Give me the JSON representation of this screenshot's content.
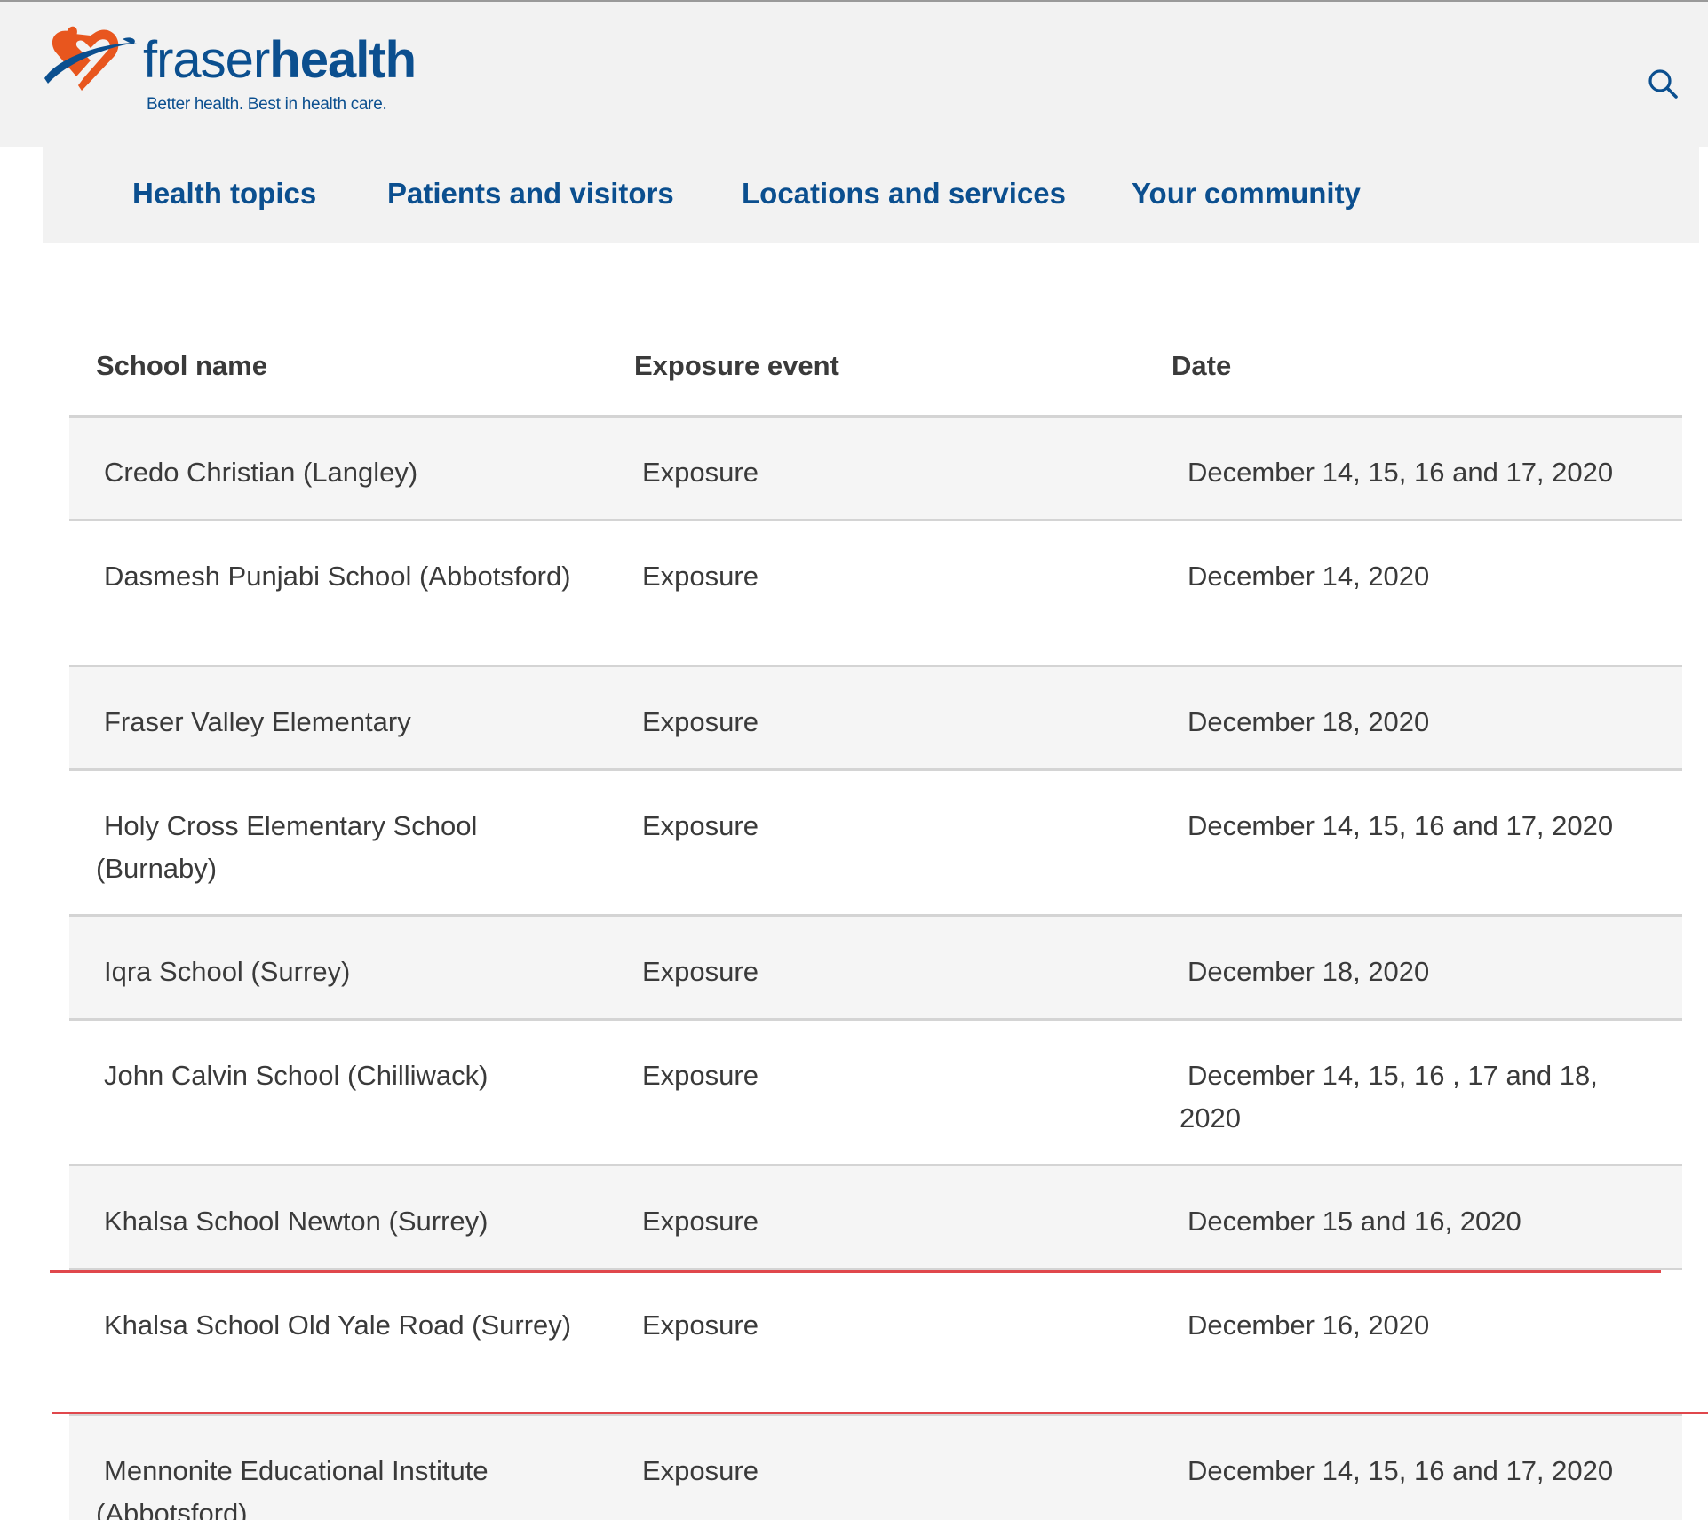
{
  "header": {
    "brand_part1": "fraser",
    "brand_part2": "health",
    "tagline": "Better health. Best in health care.",
    "search_icon": "search-icon"
  },
  "nav": {
    "items": [
      {
        "label": "Health topics"
      },
      {
        "label": "Patients and visitors"
      },
      {
        "label": "Locations and services"
      },
      {
        "label": "Your community"
      }
    ]
  },
  "table": {
    "headers": [
      "School name",
      "Exposure event",
      "Date"
    ],
    "rows": [
      {
        "name": "Credo Christian (Langley)",
        "event": "Exposure",
        "date": "December 14, 15, 16 and 17, 2020"
      },
      {
        "name": "Dasmesh Punjabi School (Abbotsford)",
        "event": "Exposure",
        "date": "December 14, 2020"
      },
      {
        "name": "Fraser Valley Elementary",
        "event": "Exposure",
        "date": "December 18, 2020"
      },
      {
        "name": "Holy Cross Elementary School (Burnaby)",
        "event": "Exposure",
        "date": "December 14, 15, 16 and 17, 2020"
      },
      {
        "name": "Iqra School (Surrey)",
        "event": "Exposure",
        "date": "December 18, 2020"
      },
      {
        "name": "John Calvin School (Chilliwack)",
        "event": "Exposure",
        "date": "December 14, 15, 16 , 17 and 18, 2020"
      },
      {
        "name": "Khalsa School Newton (Surrey)",
        "event": "Exposure",
        "date": "December 15 and 16, 2020"
      },
      {
        "name": "Khalsa School Old Yale Road (Surrey)",
        "event": "Exposure",
        "date": "December 16, 2020"
      },
      {
        "name": "Mennonite Educational Institute (Abbotsford)",
        "event": "Exposure",
        "date": "December 14, 15, 16 and 17, 2020"
      }
    ]
  },
  "colors": {
    "brand_blue": "#0b4f8f",
    "brand_orange": "#e8561e",
    "highlight_red": "#e0474c",
    "header_bg": "#f2f2f2",
    "row_shade": "#f5f5f5"
  }
}
